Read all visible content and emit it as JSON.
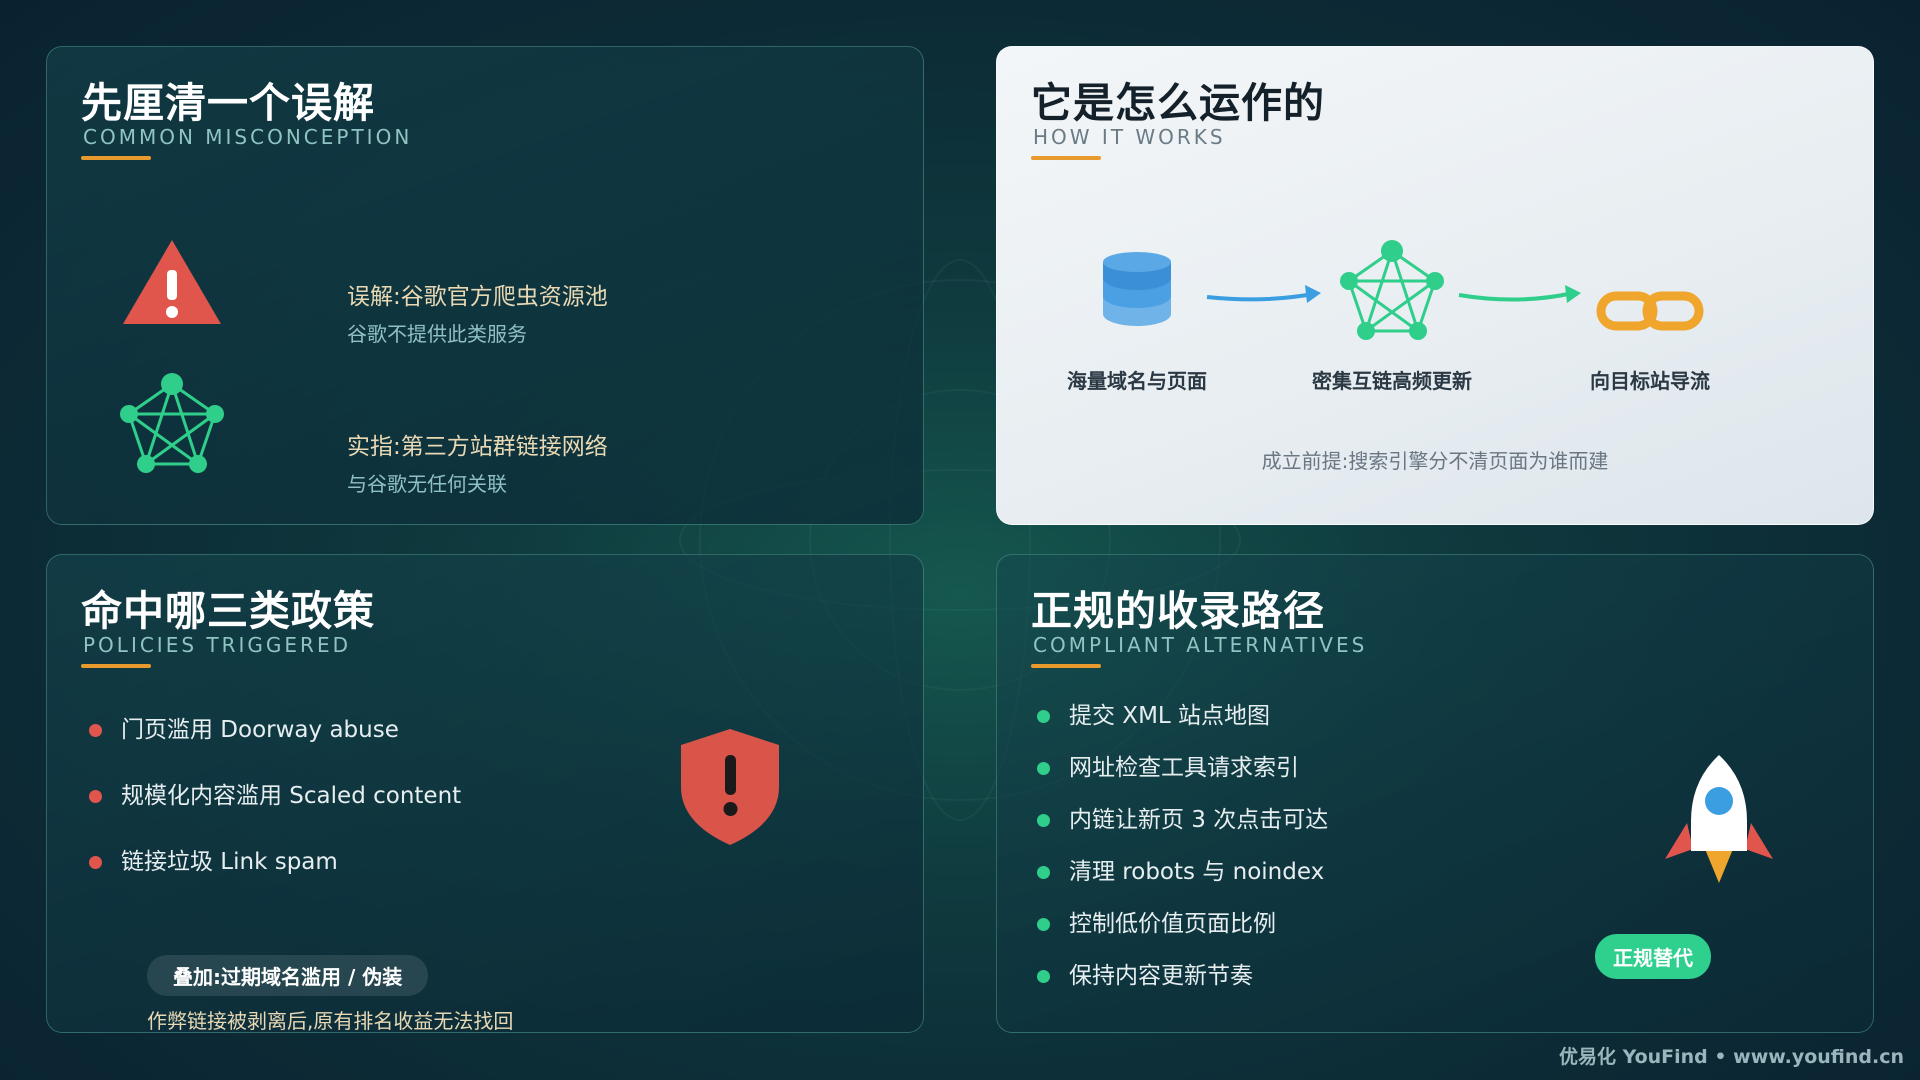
{
  "colors": {
    "accent_orange": "#e89a2c",
    "alert_red": "#e0564c",
    "network_green": "#2fce8a",
    "flow_blue": "#3b9ee0"
  },
  "misconception": {
    "title": "先厘清一个误解",
    "subtitle": "COMMON MISCONCEPTION",
    "items": [
      {
        "icon": "warning-triangle-icon",
        "heading": "误解:谷歌官方爬虫资源池",
        "desc": "谷歌不提供此类服务"
      },
      {
        "icon": "network-icon",
        "heading": "实指:第三方站群链接网络",
        "desc": "与谷歌无任何关联"
      }
    ]
  },
  "how_it_works": {
    "title": "它是怎么运作的",
    "subtitle": "HOW IT WORKS",
    "steps": [
      {
        "icon": "database-icon",
        "label": "海量域名与页面"
      },
      {
        "icon": "network-icon",
        "label": "密集互链高频更新"
      },
      {
        "icon": "link-chain-icon",
        "label": "向目标站导流"
      }
    ],
    "premise": "成立前提:搜索引擎分不清页面为谁而建"
  },
  "policies": {
    "title": "命中哪三类政策",
    "subtitle": "POLICIES TRIGGERED",
    "items": [
      "门页滥用 Doorway abuse",
      "规模化内容滥用 Scaled content",
      "链接垃圾 Link spam"
    ],
    "overlay_label": "叠加:过期域名滥用 / 伪装",
    "overlay_note": "作弊链接被剥离后,原有排名收益无法找回"
  },
  "alternatives": {
    "title": "正规的收录路径",
    "subtitle": "COMPLIANT ALTERNATIVES",
    "items": [
      "提交 XML 站点地图",
      "网址检查工具请求索引",
      "内链让新页 3 次点击可达",
      "清理 robots 与 noindex",
      "控制低价值页面比例",
      "保持内容更新节奏"
    ],
    "badge": "正规替代"
  },
  "footer": "优易化 YouFind • www.youfind.cn"
}
